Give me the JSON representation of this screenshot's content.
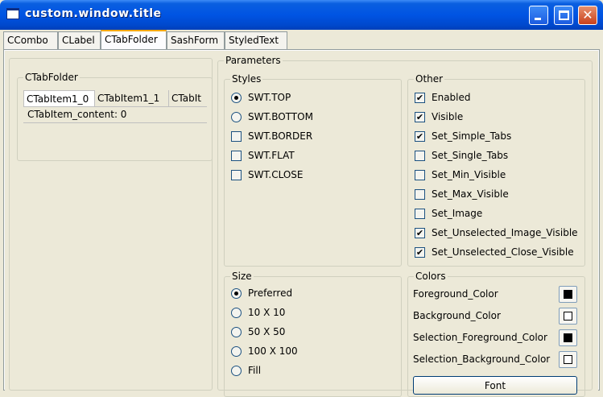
{
  "window": {
    "title": "custom.window.title",
    "minimize_icon": "minimize-icon",
    "maximize_icon": "maximize-icon",
    "close_icon": "close-icon"
  },
  "tabs": [
    {
      "label": "CCombo"
    },
    {
      "label": "CLabel"
    },
    {
      "label": "CTabFolder",
      "selected": true
    },
    {
      "label": "SashForm"
    },
    {
      "label": "StyledText"
    }
  ],
  "example": {
    "group_label": "CTabFolder",
    "tabs": [
      "CTabItem1_0",
      "CTabItem1_1",
      "CTabIt"
    ],
    "content": "CTabItem_content: 0"
  },
  "parameters": {
    "label": "Parameters",
    "styles": {
      "label": "Styles",
      "options": [
        {
          "label": "SWT.TOP",
          "type": "radio",
          "checked": true
        },
        {
          "label": "SWT.BOTTOM",
          "type": "radio",
          "checked": false
        },
        {
          "label": "SWT.BORDER",
          "type": "check",
          "checked": false
        },
        {
          "label": "SWT.FLAT",
          "type": "check",
          "checked": false
        },
        {
          "label": "SWT.CLOSE",
          "type": "check",
          "checked": false
        }
      ]
    },
    "other": {
      "label": "Other",
      "options": [
        {
          "label": "Enabled",
          "checked": true
        },
        {
          "label": "Visible",
          "checked": true
        },
        {
          "label": "Set_Simple_Tabs",
          "checked": true
        },
        {
          "label": "Set_Single_Tabs",
          "checked": false
        },
        {
          "label": "Set_Min_Visible",
          "checked": false
        },
        {
          "label": "Set_Max_Visible",
          "checked": false
        },
        {
          "label": "Set_Image",
          "checked": false
        },
        {
          "label": "Set_Unselected_Image_Visible",
          "checked": true
        },
        {
          "label": "Set_Unselected_Close_Visible",
          "checked": true
        }
      ]
    },
    "size": {
      "label": "Size",
      "options": [
        {
          "label": "Preferred",
          "checked": true
        },
        {
          "label": "10 X 10",
          "checked": false
        },
        {
          "label": "50 X 50",
          "checked": false
        },
        {
          "label": "100 X 100",
          "checked": false
        },
        {
          "label": "Fill",
          "checked": false
        }
      ]
    },
    "colors": {
      "label": "Colors",
      "items": [
        {
          "label": "Foreground_Color",
          "swatch": "#000000"
        },
        {
          "label": "Background_Color",
          "swatch": "#ffffff"
        },
        {
          "label": "Selection_Foreground_Color",
          "swatch": "#000000"
        },
        {
          "label": "Selection_Background_Color",
          "swatch": "#ffffff"
        }
      ],
      "font_button": "Font"
    }
  }
}
